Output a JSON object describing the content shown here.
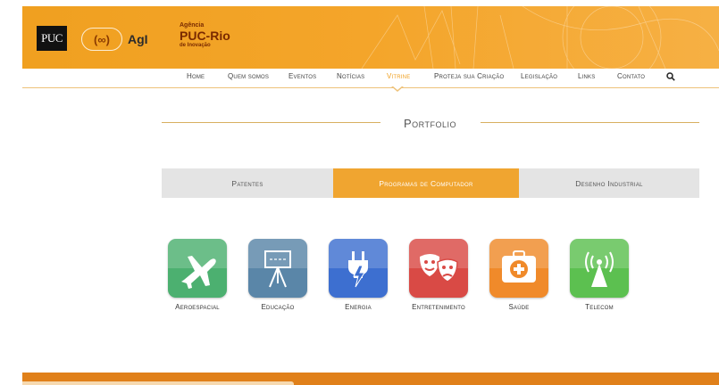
{
  "banner": {
    "puc_logo": "PUC",
    "agi_symbol": "(∞)",
    "agi_text": "AgI",
    "agency_line1": "Agência",
    "agency_line2": "PUC-Rio",
    "agency_line3": "de Inovação"
  },
  "nav": {
    "items": [
      {
        "label": "Home"
      },
      {
        "label": "Quem somos"
      },
      {
        "label": "Eventos"
      },
      {
        "label": "Notícias"
      },
      {
        "label": "Vitrine",
        "active": true
      },
      {
        "label": "Proteja sua Criação"
      },
      {
        "label": "Legislação"
      },
      {
        "label": "Links"
      },
      {
        "label": "Contato"
      }
    ],
    "search_icon": "search-icon"
  },
  "portfolio": {
    "title": "Portfolio"
  },
  "tabs": [
    {
      "label": "Patentes"
    },
    {
      "label": "Programas de Computador",
      "active": true
    },
    {
      "label": "Desenho Industrial"
    }
  ],
  "categories": [
    {
      "label": "Aeroespacial",
      "icon": "airplane-icon",
      "color": "#4cb070"
    },
    {
      "label": "Educação",
      "icon": "easel-icon",
      "color": "#5a86a8"
    },
    {
      "label": "Energia",
      "icon": "power-plug-icon",
      "color": "#3d6fd0"
    },
    {
      "label": "Entretenimento",
      "icon": "theater-masks-icon",
      "color": "#d94a45"
    },
    {
      "label": "Saúde",
      "icon": "first-aid-kit-icon",
      "color": "#f08a2a"
    },
    {
      "label": "Telecom",
      "icon": "antenna-icon",
      "color": "#5cc050"
    }
  ],
  "colors": {
    "accent": "#f0a020",
    "tab_active": "#f0a530",
    "footer": "#e0801a"
  }
}
